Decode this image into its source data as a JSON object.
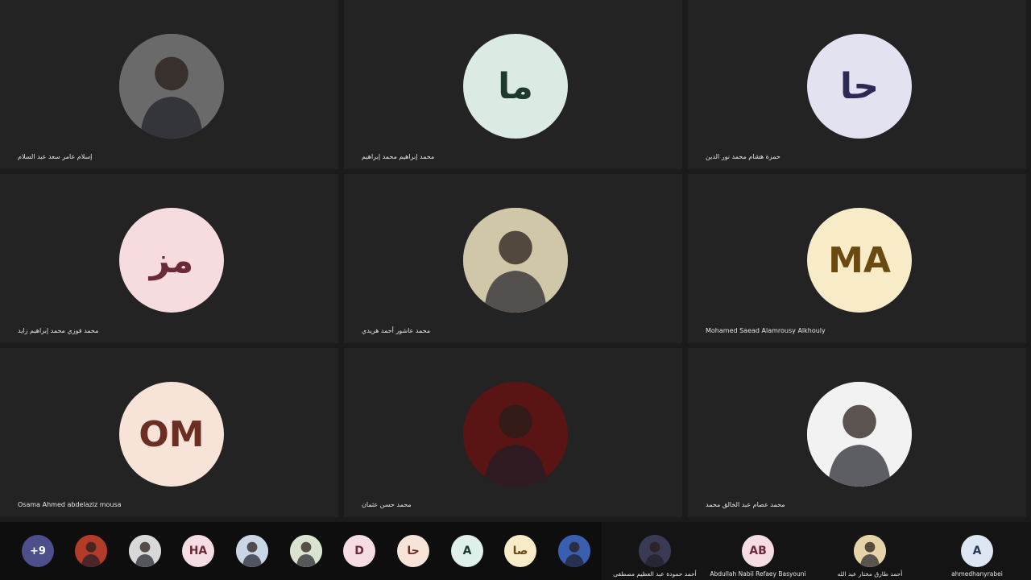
{
  "tiles": [
    {
      "name": "إسلام عامر سعد عبد السلام",
      "initials": "",
      "avatar_type": "photo",
      "avatar_bg": "#6a6a6a",
      "avatar_fg": "#000000"
    },
    {
      "name": "محمد إبراهيم محمد إبراهيم",
      "initials": "ما",
      "avatar_type": "initials",
      "avatar_bg": "#dbeae2",
      "avatar_fg": "#1e3a2e"
    },
    {
      "name": "حمزة هشام محمد نور الدين",
      "initials": "حا",
      "avatar_type": "initials",
      "avatar_bg": "#e3e2f0",
      "avatar_fg": "#2a2a55"
    },
    {
      "name": "محمد فوزي محمد إبراهيم زايد",
      "initials": "مز",
      "avatar_type": "initials",
      "avatar_bg": "#f6dcdf",
      "avatar_fg": "#6b2a38"
    },
    {
      "name": "محمد عاشور أحمد هريدي",
      "initials": "",
      "avatar_type": "photo",
      "avatar_bg": "#cfc7a8",
      "avatar_fg": "#000000"
    },
    {
      "name": "Mohamed Saead Alamrousy Alkhouly",
      "initials": "MA",
      "avatar_type": "initials",
      "avatar_bg": "#f8ecc8",
      "avatar_fg": "#6a4a10"
    },
    {
      "name": "Osama Ahmed abdelaziz mousa",
      "initials": "OM",
      "avatar_type": "initials",
      "avatar_bg": "#f8e3d9",
      "avatar_fg": "#6b2e22"
    },
    {
      "name": "محمد حسن عثمان",
      "initials": "",
      "avatar_type": "photo",
      "avatar_bg": "#5a1414",
      "avatar_fg": "#000000"
    },
    {
      "name": "محمد عصام عبد الخالق محمد",
      "initials": "",
      "avatar_type": "photo",
      "avatar_bg": "#f2f2f2",
      "avatar_fg": "#000000"
    }
  ],
  "strip": {
    "overflow_label": "+9",
    "avatars": [
      {
        "initials": "",
        "type": "photo",
        "bg": "#b23b2a",
        "fg": "#000000"
      },
      {
        "initials": "",
        "type": "photo",
        "bg": "#d8d8d8",
        "fg": "#000000"
      },
      {
        "initials": "HA",
        "type": "initials",
        "bg": "#f6dde3",
        "fg": "#6b2a38"
      },
      {
        "initials": "",
        "type": "photo",
        "bg": "#c9d6e6",
        "fg": "#000000"
      },
      {
        "initials": "",
        "type": "photo",
        "bg": "#d9e3d0",
        "fg": "#000000"
      },
      {
        "initials": "D",
        "type": "initials",
        "bg": "#f6dde3",
        "fg": "#6b2a38"
      },
      {
        "initials": "حا",
        "type": "initials",
        "bg": "#f8e3d9",
        "fg": "#6b2e22"
      },
      {
        "initials": "A",
        "type": "initials",
        "bg": "#dff0ea",
        "fg": "#1e3a2e"
      },
      {
        "initials": "صا",
        "type": "initials",
        "bg": "#f8ecc8",
        "fg": "#6a4a10"
      },
      {
        "initials": "",
        "type": "photo",
        "bg": "#3a5fb0",
        "fg": "#000000"
      }
    ],
    "people": [
      {
        "name": "أحمد حمودة عبد العظيم مصطفى",
        "initials": "",
        "type": "photo",
        "bg": "#3a3a55",
        "fg": "#000000"
      },
      {
        "name": "Abdullah Nabil Refaey Basyouni",
        "initials": "AB",
        "type": "initials",
        "bg": "#f6dde3",
        "fg": "#6b2a38"
      },
      {
        "name": "أحمد طارق مختار عبد الله",
        "initials": "",
        "type": "photo",
        "bg": "#e4d3a6",
        "fg": "#000000"
      },
      {
        "name": "ahmedhanyrabei",
        "initials": "A",
        "type": "initials",
        "bg": "#dde6f3",
        "fg": "#2a3a5a"
      }
    ]
  }
}
